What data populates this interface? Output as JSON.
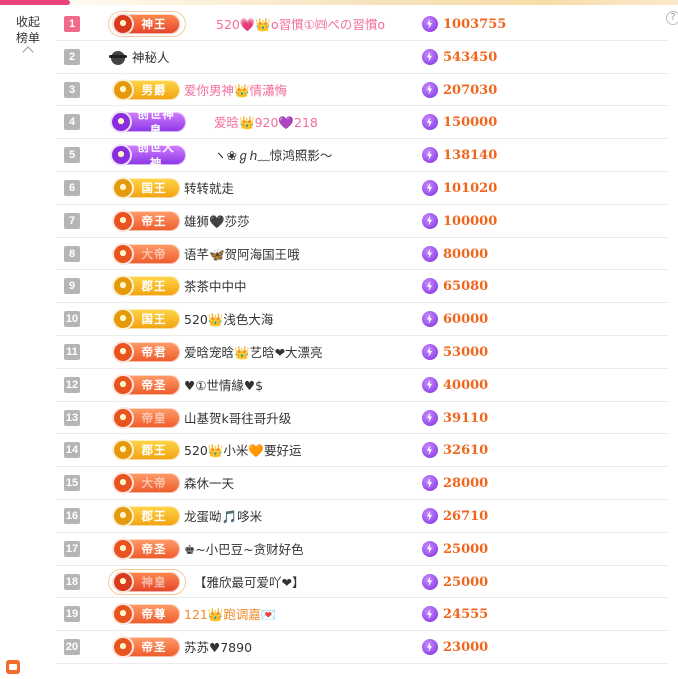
{
  "sidebar": {
    "collapse_line1": "收起",
    "collapse_line2": "榜单"
  },
  "help_icon": "?",
  "rows": [
    {
      "rank": "1",
      "badge": "神王",
      "name": "520💗👑o習慣①㈣ぺの習慣o",
      "score": "1003755"
    },
    {
      "rank": "2",
      "badge": "",
      "name": "神秘人",
      "score": "543450"
    },
    {
      "rank": "3",
      "badge": "男爵",
      "name": "爱你男神👑情瀟悔",
      "score": "207030"
    },
    {
      "rank": "4",
      "badge": "创世神皇",
      "name": "爱晗👑920💜218",
      "score": "150000"
    },
    {
      "rank": "5",
      "badge": "创世大神",
      "name": "ヽ❀ℊℎ﹏惊鸿照影～",
      "score": "138140"
    },
    {
      "rank": "6",
      "badge": "国王",
      "name": "转转就走",
      "score": "101020"
    },
    {
      "rank": "7",
      "badge": "帝王",
      "name": "雄狮🖤莎莎",
      "score": "100000"
    },
    {
      "rank": "8",
      "badge": "大帝",
      "name": "语芊🦋贺阿海国王哦",
      "score": "80000"
    },
    {
      "rank": "9",
      "badge": "郡王",
      "name": "茶茶中中中",
      "score": "65080"
    },
    {
      "rank": "10",
      "badge": "国王",
      "name": "520👑浅色大海",
      "score": "60000"
    },
    {
      "rank": "11",
      "badge": "帝君",
      "name": "爱晗宠晗👑艺晗❤大漂亮",
      "score": "53000"
    },
    {
      "rank": "12",
      "badge": "帝圣",
      "name": "♥①世情緣♥$",
      "score": "40000"
    },
    {
      "rank": "13",
      "badge": "帝皇",
      "name": "山基贺k哥往哥升级",
      "score": "39110"
    },
    {
      "rank": "14",
      "badge": "郡王",
      "name": "520👑小米🧡要好运",
      "score": "32610"
    },
    {
      "rank": "15",
      "badge": "大帝",
      "name": "森休一天",
      "score": "28000"
    },
    {
      "rank": "16",
      "badge": "郡王",
      "name": "龙蛋呦🎵哆米",
      "score": "26710"
    },
    {
      "rank": "17",
      "badge": "帝圣",
      "name": "♚~小巴豆~贪财好色",
      "score": "25000"
    },
    {
      "rank": "18",
      "badge": "神皇",
      "name": "【雅欣最可爱吖❤】",
      "score": "25000"
    },
    {
      "rank": "19",
      "badge": "帝尊",
      "name": "121👑跑调嘉💌",
      "score": "24555"
    },
    {
      "rank": "20",
      "badge": "帝圣",
      "name": "苏苏♥7890",
      "score": "23000"
    }
  ]
}
